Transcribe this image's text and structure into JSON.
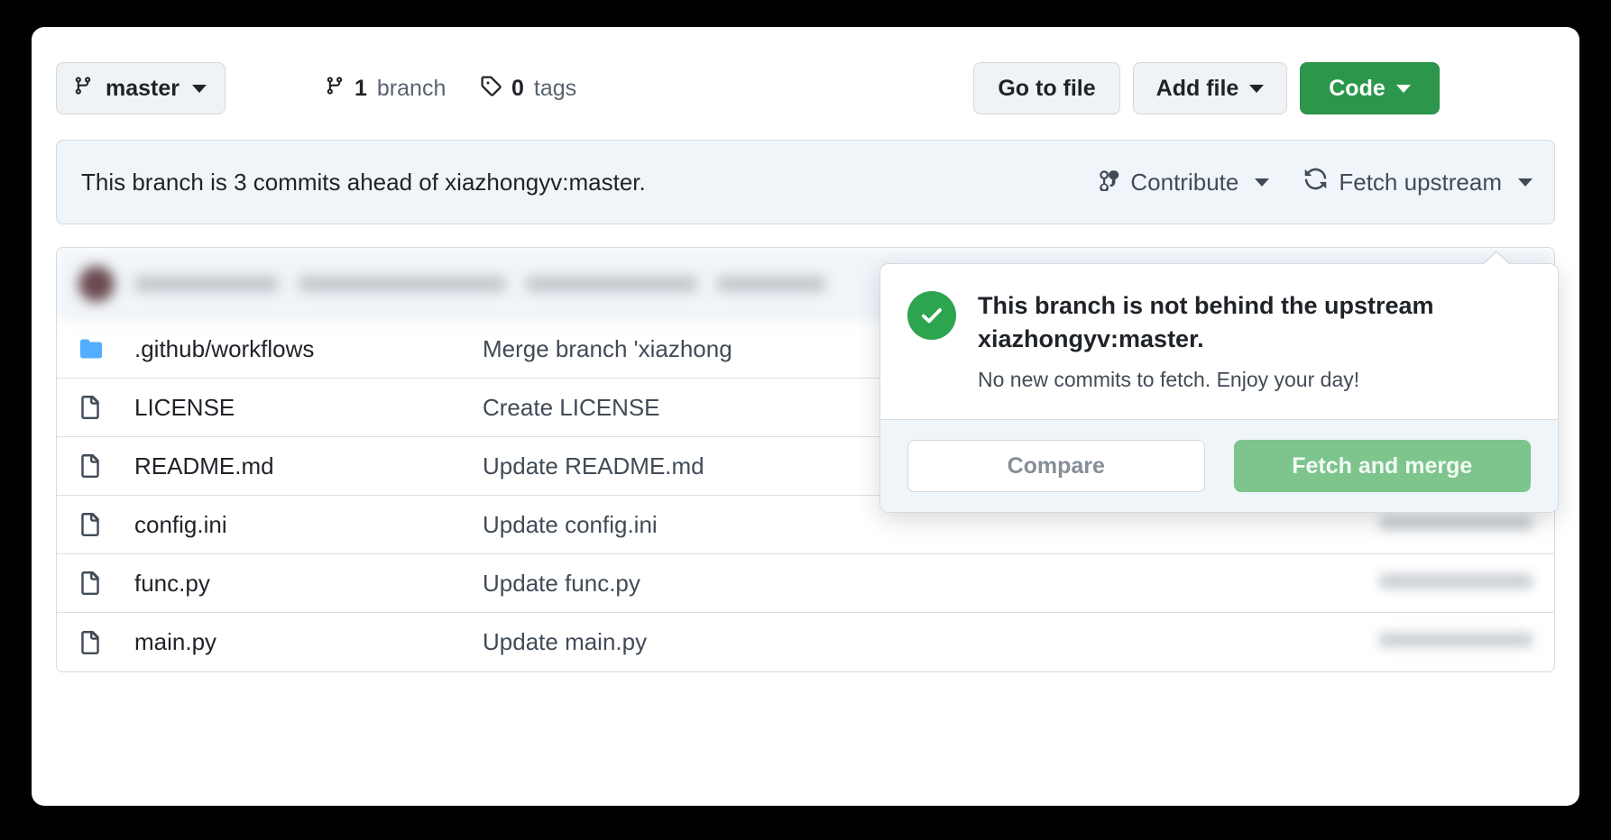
{
  "toolbar": {
    "branch_selector": {
      "label": "master",
      "icon": "git-branch-icon",
      "caret": "chevron-down-icon"
    },
    "branch_count": {
      "number": "1",
      "label": "branch",
      "icon": "git-branch-icon"
    },
    "tag_count": {
      "number": "0",
      "label": "tags",
      "icon": "tag-icon"
    },
    "go_to_file_label": "Go to file",
    "add_file_label": "Add file",
    "code_label": "Code",
    "code_color": "#2c974b"
  },
  "branch_banner": {
    "status_text": "This branch is 3 commits ahead of xiazhongyv:master.",
    "contribute_label": "Contribute",
    "contribute_icon": "git-pull-request-icon",
    "fetch_upstream_label": "Fetch upstream",
    "fetch_upstream_icon": "sync-icon"
  },
  "file_list": {
    "columns": [
      "name",
      "commit_message",
      "time"
    ],
    "rows": [
      {
        "icon": "folder-icon",
        "type": "directory",
        "name": ".github/workflows",
        "commit_message": "Merge branch 'xiazhong"
      },
      {
        "icon": "file-icon",
        "type": "file",
        "name": "LICENSE",
        "commit_message": "Create LICENSE"
      },
      {
        "icon": "file-icon",
        "type": "file",
        "name": "README.md",
        "commit_message": "Update README.md"
      },
      {
        "icon": "file-icon",
        "type": "file",
        "name": "config.ini",
        "commit_message": "Update config.ini"
      },
      {
        "icon": "file-icon",
        "type": "file",
        "name": "func.py",
        "commit_message": "Update func.py"
      },
      {
        "icon": "file-icon",
        "type": "file",
        "name": "main.py",
        "commit_message": "Update main.py"
      }
    ]
  },
  "fetch_popover": {
    "status_icon": "check-circle-icon",
    "status_color": "#2da44e",
    "title": "This branch is not behind the upstream xiazhongyv:master.",
    "subtitle": "No new commits to fetch. Enjoy your day!",
    "compare_label": "Compare",
    "fetch_and_merge_label": "Fetch and merge",
    "fetch_and_merge_color": "#7ec48d"
  }
}
